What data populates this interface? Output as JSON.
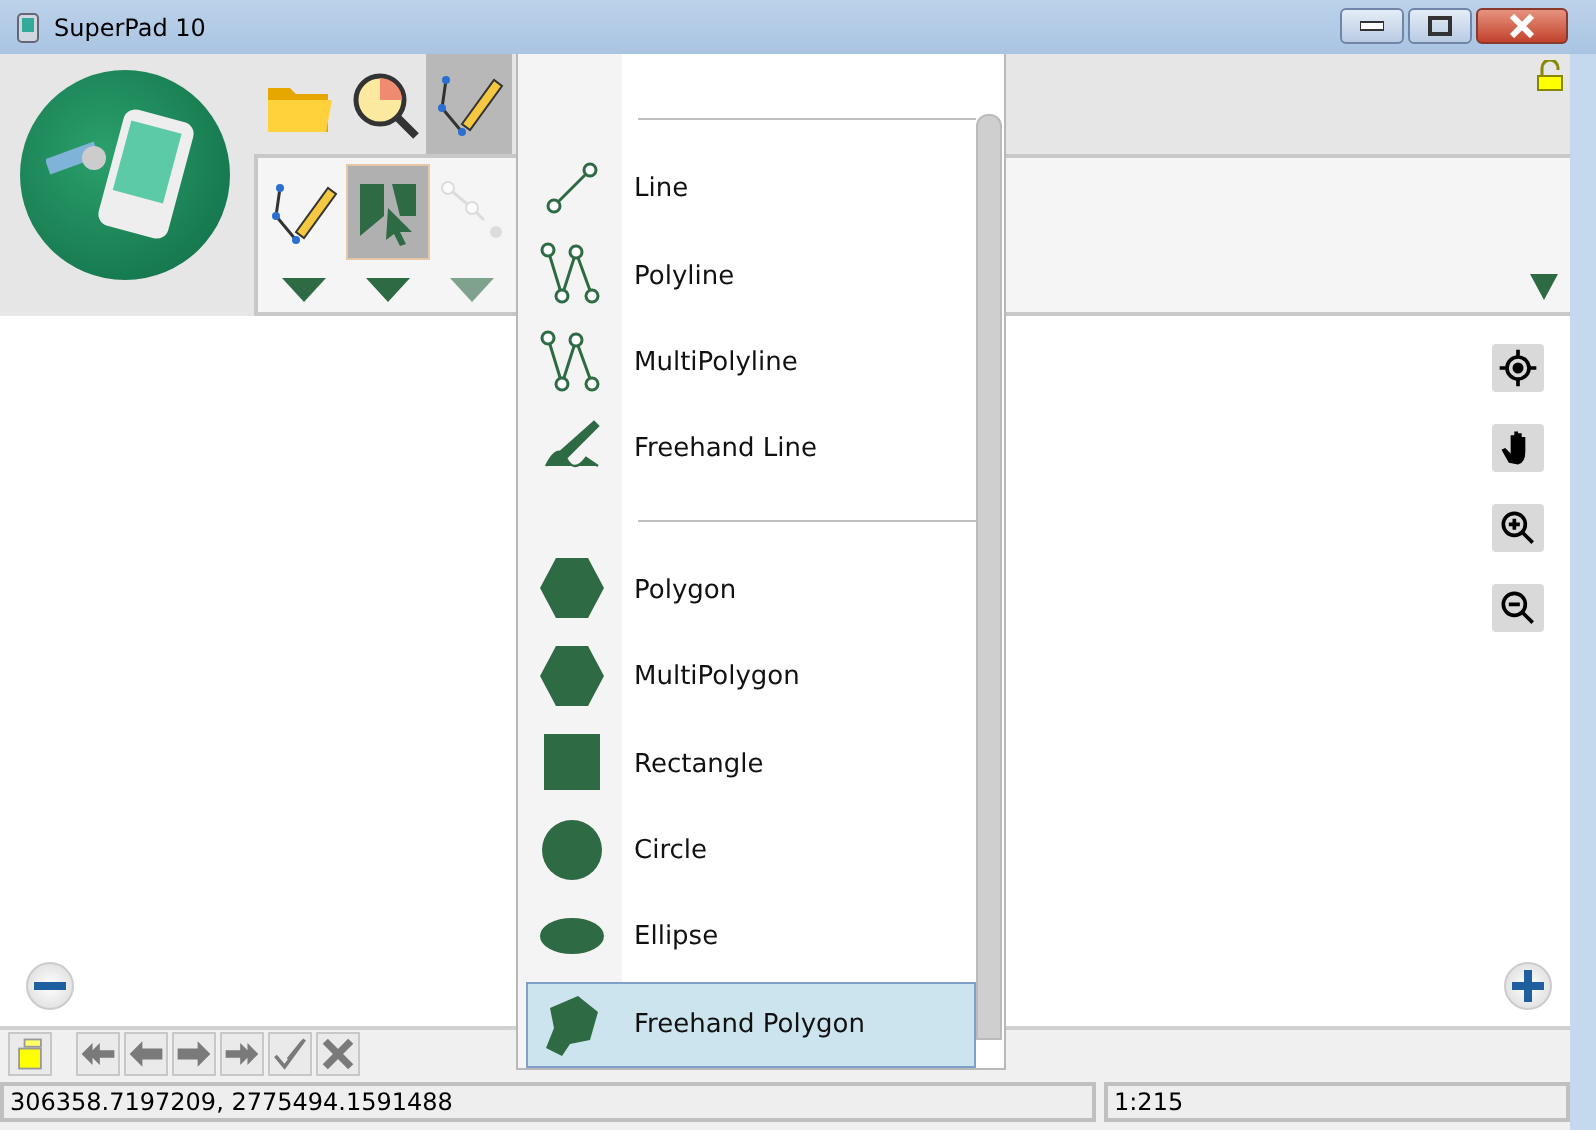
{
  "window": {
    "title": "SuperPad 10"
  },
  "top_tabs": [
    {
      "kind": "folder",
      "selected": false
    },
    {
      "kind": "query",
      "selected": false
    },
    {
      "kind": "edit",
      "selected": true
    }
  ],
  "ribbon_buttons": [
    {
      "kind": "edit",
      "selected": false,
      "disabled": false
    },
    {
      "kind": "select",
      "selected": true,
      "disabled": false
    },
    {
      "kind": "node",
      "selected": false,
      "disabled": true
    }
  ],
  "menu": {
    "items": [
      {
        "kind": "separator"
      },
      {
        "kind": "line",
        "label": "Line",
        "selected": false
      },
      {
        "kind": "polyline",
        "label": "Polyline",
        "selected": false
      },
      {
        "kind": "multipolyline",
        "label": "MultiPolyline",
        "selected": false
      },
      {
        "kind": "freehand-line",
        "label": "Freehand Line",
        "selected": false
      },
      {
        "kind": "separator"
      },
      {
        "kind": "polygon",
        "label": "Polygon",
        "selected": false
      },
      {
        "kind": "multipolygon",
        "label": "MultiPolygon",
        "selected": false
      },
      {
        "kind": "rectangle",
        "label": "Rectangle",
        "selected": false
      },
      {
        "kind": "circle",
        "label": "Circle",
        "selected": false
      },
      {
        "kind": "ellipse",
        "label": "Ellipse",
        "selected": false
      },
      {
        "kind": "freehand-polygon",
        "label": "Freehand Polygon",
        "selected": true
      }
    ]
  },
  "map_tools": [
    {
      "kind": "locate"
    },
    {
      "kind": "pan"
    },
    {
      "kind": "zoom-in"
    },
    {
      "kind": "zoom-out"
    }
  ],
  "nav_buttons": [
    {
      "kind": "layer"
    },
    {
      "kind": "first"
    },
    {
      "kind": "prev"
    },
    {
      "kind": "next"
    },
    {
      "kind": "last"
    },
    {
      "kind": "confirm"
    },
    {
      "kind": "cancel"
    }
  ],
  "status_bar": {
    "coordinates": "306358.7197209, 2775494.1591488",
    "scale": "1:215"
  }
}
